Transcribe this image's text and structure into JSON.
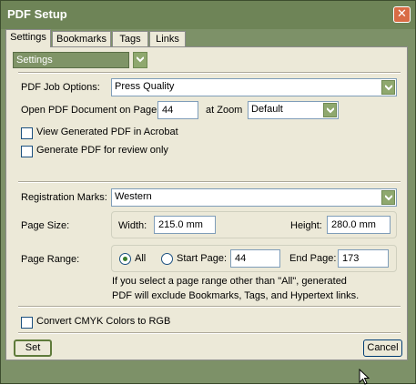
{
  "window": {
    "title": "PDF Setup",
    "close_symbol": "✕"
  },
  "tabs": [
    {
      "label": "Settings",
      "active": true
    },
    {
      "label": "Bookmarks",
      "active": false
    },
    {
      "label": "Tags",
      "active": false
    },
    {
      "label": "Links",
      "active": false
    }
  ],
  "settings_selector": {
    "value": "Settings"
  },
  "job_options": {
    "label": "PDF Job Options:",
    "value": "Press Quality"
  },
  "open_page": {
    "label": "Open PDF Document on Page",
    "value": "44",
    "zoom_label": "at Zoom",
    "zoom_value": "Default"
  },
  "checks": {
    "view_in_acrobat": {
      "label": "View Generated PDF in Acrobat",
      "checked": false
    },
    "review_only": {
      "label": "Generate PDF for review only",
      "checked": false
    },
    "convert_cmyk": {
      "label": "Convert CMYK Colors to RGB",
      "checked": false
    }
  },
  "registration": {
    "label": "Registration Marks:",
    "value": "Western"
  },
  "page_size": {
    "label": "Page Size:",
    "width_label": "Width:",
    "width_value": "215.0 mm",
    "height_label": "Height:",
    "height_value": "280.0 mm"
  },
  "page_range": {
    "label": "Page Range:",
    "all_label": "All",
    "start_label": "Start Page:",
    "start_value": "44",
    "end_label": "End Page:",
    "end_value": "173",
    "selected": "All",
    "note_line1": "If you select a page range other than \"All\",  generated",
    "note_line2": "PDF will exclude Bookmarks, Tags, and Hypertext links."
  },
  "buttons": {
    "set": "Set",
    "cancel": "Cancel"
  },
  "colors": {
    "frame": "#7d9168",
    "panel": "#ece9d8",
    "close": "#d96c45"
  }
}
